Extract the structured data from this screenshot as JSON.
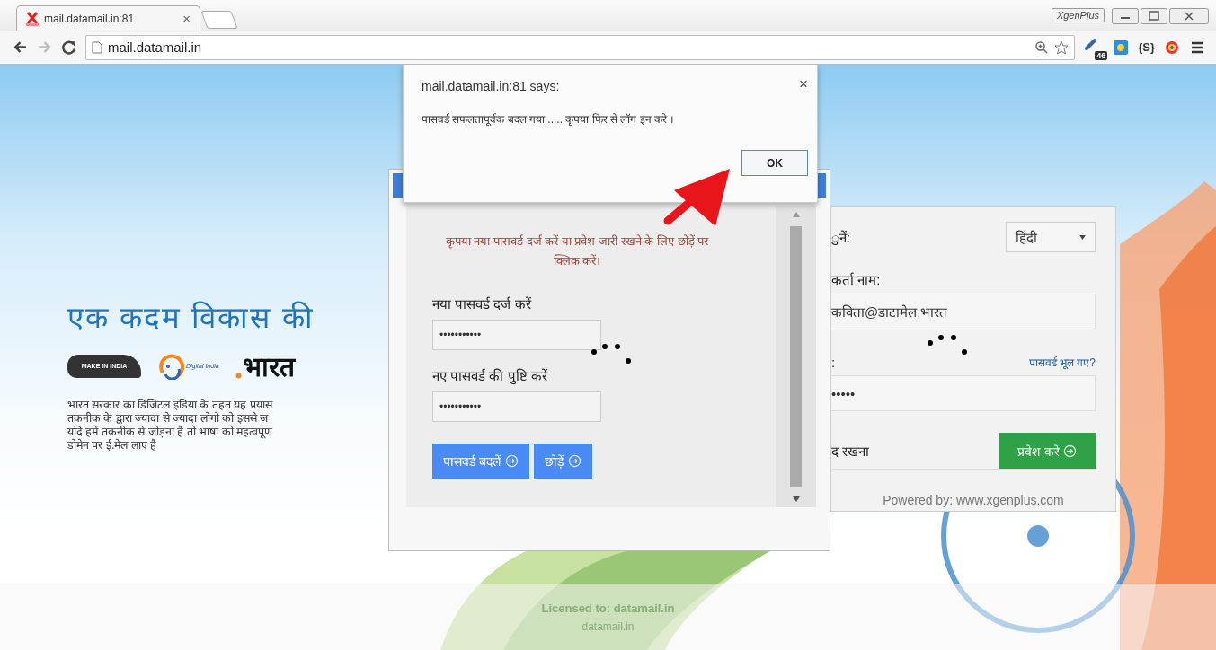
{
  "browser": {
    "tab": {
      "title": "mail.datamail.in:81",
      "close": "×"
    },
    "profile_button": "XgenPlus",
    "url": "mail.datamail.in",
    "extension_badge": "46",
    "extension_label": "{S}"
  },
  "hero": {
    "heading": "एक कदम विकास की",
    "logos": {
      "make_in_india": "MAKE IN INDIA",
      "digital_india": "Digital India",
      "bharat": "भारत"
    },
    "paragraph_lines": [
      "भारत सरकार का डिजिटल इंडिया के तहत यह प्रयास",
      "तकनीक के द्वारा ज्यादा से ज्यादा लोगो को इससे ज",
      "यदि हमें तकनीक से जोड़ना है तो भाषा को महत्वपूण",
      "डोमेन पर ई.मेल लाए है"
    ]
  },
  "login_panel": {
    "language_label": "ुनें:",
    "language_value": "हिंदी",
    "username_label": "कर्ता नाम:",
    "username_value": "कविता@डाटामेल.भारत",
    "password_label": ":",
    "forgot_link": "पासवर्ड भूल गए?",
    "password_value": "•••••",
    "remember_label": "द रखना",
    "login_button": "प्रवेश करे",
    "powered_by": "Powered by: www.xgenplus.com"
  },
  "footer": {
    "license": "Licensed to: datamail.in",
    "domain": "datamail.in"
  },
  "modal": {
    "message": "कृपया नया पासवर्ड दर्ज करें या प्रवेश जारी रखने के लिए छोड़ें पर क्लिक करें।",
    "fields": [
      {
        "label": "नया पासवर्ड दर्ज करें",
        "value": "•••••••••••"
      },
      {
        "label": "नए पासवर्ड की पुष्टि करें",
        "value": "•••••••••••"
      }
    ],
    "buttons": [
      {
        "label": "पासवर्ड बदलें"
      },
      {
        "label": "छोड़ें"
      }
    ]
  },
  "alert": {
    "title": "mail.datamail.in:81 says:",
    "message": "पासवर्ड सफलतापूर्वक बदल गया ..... कृपया फिर से लॉग इन करे ।",
    "close": "×",
    "ok": "OK"
  }
}
